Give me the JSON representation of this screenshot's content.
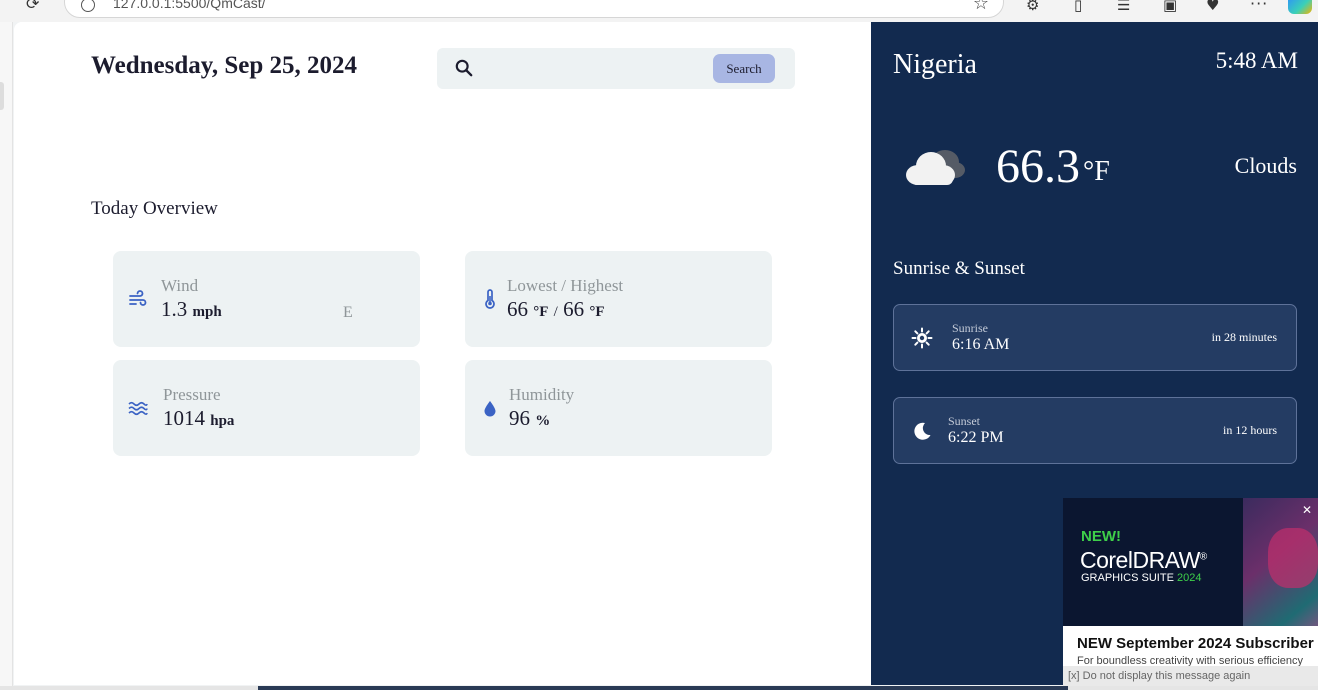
{
  "browser": {
    "url": "127.0.0.1:5500/QmCast/"
  },
  "main": {
    "date": "Wednesday, Sep 25, 2024",
    "search": {
      "placeholder": "",
      "button_label": "Search"
    },
    "overview_title": "Today Overview",
    "cards": {
      "wind": {
        "label": "Wind",
        "value": "1.3",
        "unit": "mph",
        "direction": "E",
        "icon": "wind-icon"
      },
      "minmax": {
        "label": "Lowest / Highest",
        "low": "66",
        "low_unit": "°F",
        "separator": "/",
        "high": "66",
        "high_unit": "°F",
        "icon": "thermometer-icon"
      },
      "pressure": {
        "label": "Pressure",
        "value": "1014",
        "unit": "hpa",
        "icon": "pressure-waves-icon"
      },
      "humidity": {
        "label": "Humidity",
        "value": "96",
        "unit": "%",
        "icon": "water-drop-icon"
      }
    }
  },
  "side": {
    "country": "Nigeria",
    "time": "5:48 AM",
    "temperature": "66.3",
    "temperature_unit": "°F",
    "condition": "Clouds",
    "condition_icon": "cloud-icon",
    "sun_title": "Sunrise & Sunset",
    "sunrise": {
      "label": "Sunrise",
      "time": "6:16 AM",
      "relative": "in 28 minutes",
      "icon": "sun-icon"
    },
    "sunset": {
      "label": "Sunset",
      "time": "6:22 PM",
      "relative": "in 12 hours",
      "icon": "moon-icon"
    }
  },
  "ad": {
    "new_label": "NEW!",
    "brand": "CorelDRAW",
    "brand_mark": "®",
    "suite": "GRAPHICS SUITE",
    "year": "2024",
    "headline": "NEW September 2024 Subscriber",
    "body": "For boundless creativity with serious efficiency",
    "close": "✕",
    "footer": "[x] Do not display this message again"
  },
  "colors": {
    "side_bg": "#122a4f",
    "card_bg": "#edf2f3",
    "accent_icon": "#3b63c4",
    "search_button": "#a8b6e3"
  }
}
